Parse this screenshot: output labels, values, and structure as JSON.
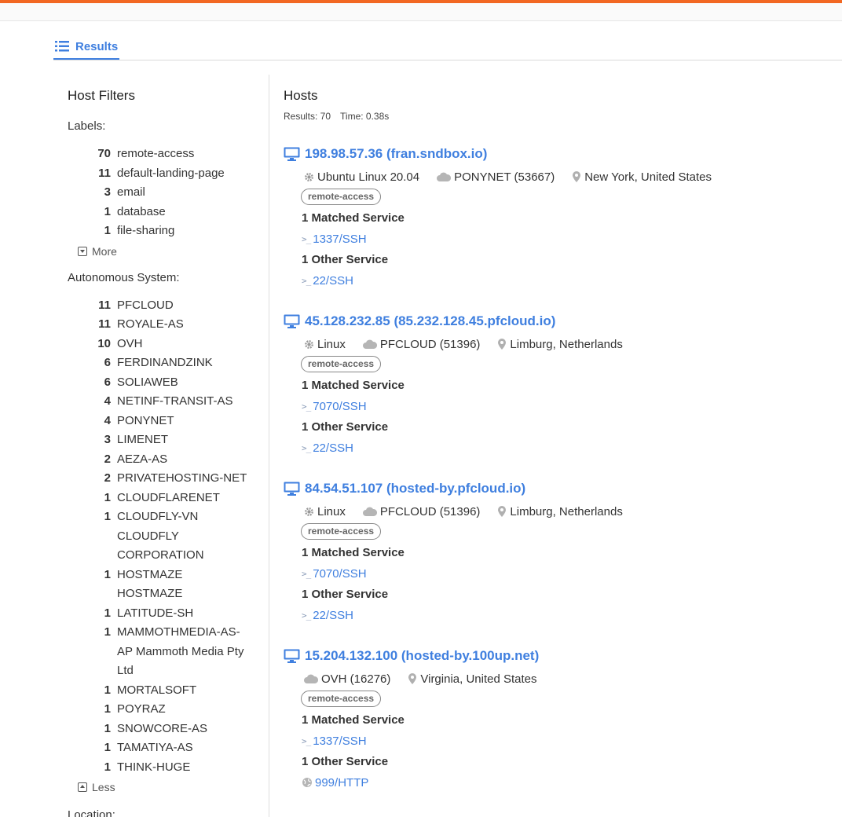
{
  "tabs": {
    "results_label": "Results"
  },
  "sidebar": {
    "title": "Host Filters",
    "labels": {
      "heading": "Labels:",
      "items": [
        {
          "count": "70",
          "name": "remote-access"
        },
        {
          "count": "11",
          "name": "default-landing-page"
        },
        {
          "count": "3",
          "name": "email"
        },
        {
          "count": "1",
          "name": "database"
        },
        {
          "count": "1",
          "name": "file-sharing"
        }
      ],
      "more_label": "More"
    },
    "asn": {
      "heading": "Autonomous System:",
      "items": [
        {
          "count": "11",
          "name": "PFCLOUD"
        },
        {
          "count": "11",
          "name": "ROYALE-AS"
        },
        {
          "count": "10",
          "name": "OVH"
        },
        {
          "count": "6",
          "name": "FERDINANDZINK"
        },
        {
          "count": "6",
          "name": "SOLIAWEB"
        },
        {
          "count": "4",
          "name": "NETINF-TRANSIT-AS"
        },
        {
          "count": "4",
          "name": "PONYNET"
        },
        {
          "count": "3",
          "name": "LIMENET"
        },
        {
          "count": "2",
          "name": "AEZA-AS"
        },
        {
          "count": "2",
          "name": "PRIVATEHOSTING-NET"
        },
        {
          "count": "1",
          "name": "CLOUDFLARENET"
        },
        {
          "count": "1",
          "name": "CLOUDFLY-VN CLOUDFLY CORPORATION"
        },
        {
          "count": "1",
          "name": "HOSTMAZE HOSTMAZE"
        },
        {
          "count": "1",
          "name": "LATITUDE-SH"
        },
        {
          "count": "1",
          "name": "MAMMOTHMEDIA-AS-AP Mammoth Media Pty Ltd"
        },
        {
          "count": "1",
          "name": "MORTALSOFT"
        },
        {
          "count": "1",
          "name": "POYRAZ"
        },
        {
          "count": "1",
          "name": "SNOWCORE-AS"
        },
        {
          "count": "1",
          "name": "TAMATIYA-AS"
        },
        {
          "count": "1",
          "name": "THINK-HUGE"
        }
      ],
      "less_label": "Less"
    },
    "location_heading": "Location:"
  },
  "main": {
    "title": "Hosts",
    "results": "Results: 70",
    "time": "Time: 0.38s",
    "hosts": [
      {
        "title": "198.98.57.36 (fran.sndbox.io)",
        "os": "Ubuntu Linux 20.04",
        "asn": "PONYNET (53667)",
        "location": "New York, United States",
        "tag": "remote-access",
        "matched_heading": "1 Matched Service",
        "matched": "1337/SSH",
        "other_heading": "1 Other Service",
        "other": "22/SSH",
        "other_icon": "terminal-icon"
      },
      {
        "title": "45.128.232.85 (85.232.128.45.pfcloud.io)",
        "os": "Linux",
        "asn": "PFCLOUD (51396)",
        "location": "Limburg, Netherlands",
        "tag": "remote-access",
        "matched_heading": "1 Matched Service",
        "matched": "7070/SSH",
        "other_heading": "1 Other Service",
        "other": "22/SSH",
        "other_icon": "terminal-icon"
      },
      {
        "title": "84.54.51.107 (hosted-by.pfcloud.io)",
        "os": "Linux",
        "asn": "PFCLOUD (51396)",
        "location": "Limburg, Netherlands",
        "tag": "remote-access",
        "matched_heading": "1 Matched Service",
        "matched": "7070/SSH",
        "other_heading": "1 Other Service",
        "other": "22/SSH",
        "other_icon": "terminal-icon"
      },
      {
        "title": "15.204.132.100 (hosted-by.100up.net)",
        "os": "",
        "asn": "OVH (16276)",
        "location": "Virginia, United States",
        "tag": "remote-access",
        "matched_heading": "1 Matched Service",
        "matched": "1337/SSH",
        "other_heading": "1 Other Service",
        "other": "999/HTTP",
        "other_icon": "globe-icon"
      }
    ]
  },
  "colors": {
    "accent": "#3f7fdf",
    "brand_bar": "#f26722"
  }
}
